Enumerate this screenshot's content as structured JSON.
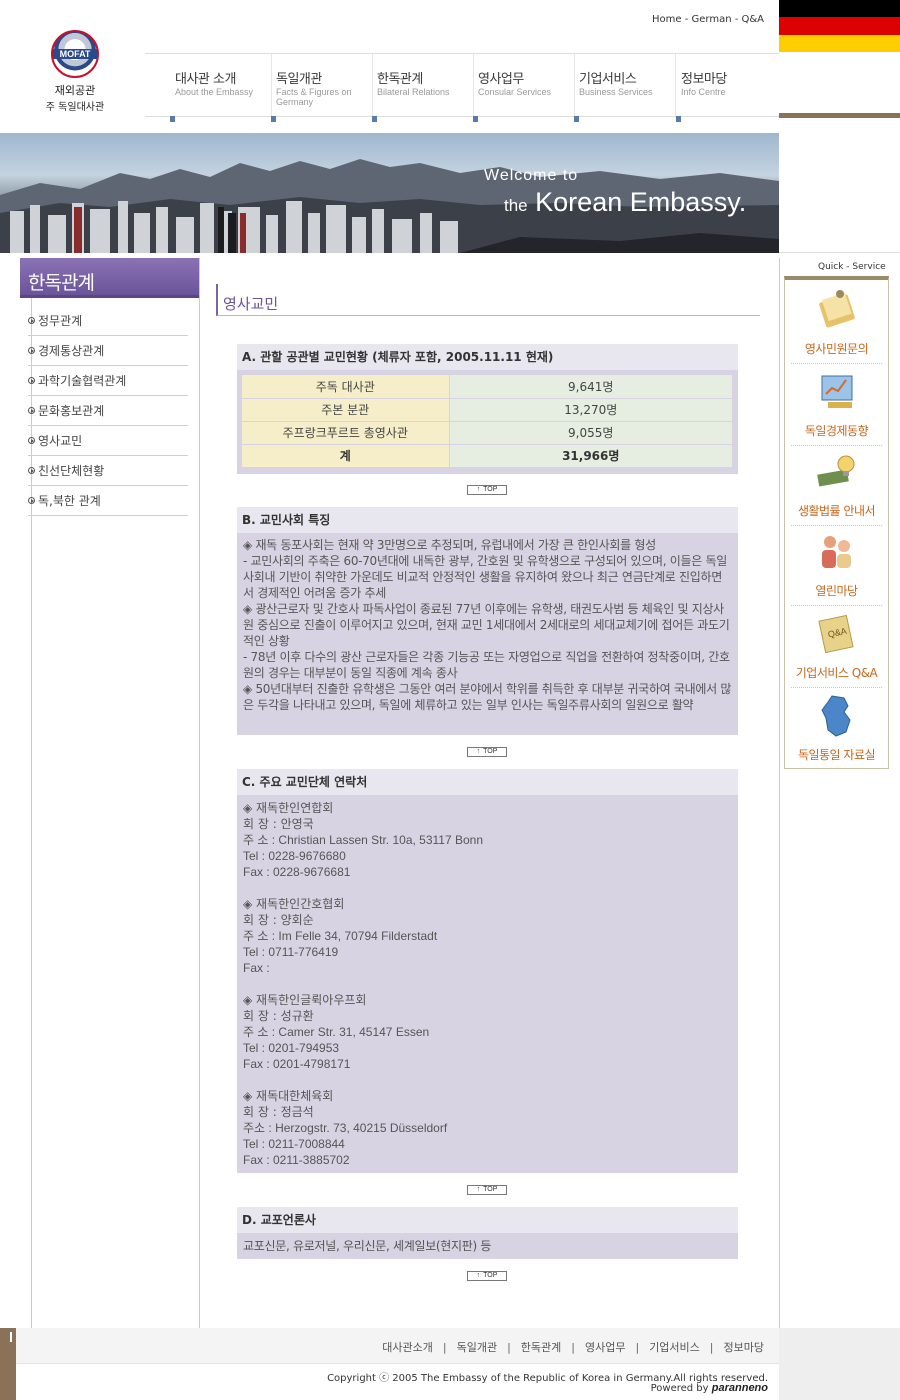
{
  "logo": {
    "emblem_text": "MOFAT",
    "line1": "재외공관",
    "line2": "주 독일대사관"
  },
  "topnav": [
    "Home",
    "German",
    "Q&A"
  ],
  "topnav_sep": " - ",
  "flag_colors": [
    "#000000",
    "#dd0000",
    "#ffce00"
  ],
  "gnb": [
    {
      "ko": "대사관 소개",
      "en": "About the Embassy"
    },
    {
      "ko": "독일개관",
      "en": "Facts & Figures on Germany"
    },
    {
      "ko": "한독관계",
      "en": "Bilateral Relations"
    },
    {
      "ko": "영사업무",
      "en": "Consular Services"
    },
    {
      "ko": "기업서비스",
      "en": "Business Services"
    },
    {
      "ko": "정보마당",
      "en": "Info Centre"
    }
  ],
  "banner": {
    "welcome": "Welcome to",
    "the": "the",
    "title": "Korean Embassy."
  },
  "lnb": {
    "title": "한독관계",
    "items": [
      "정무관계",
      "경제통상관계",
      "과학기술협력관계",
      "문화홍보관계",
      "영사교민",
      "친선단체현황",
      "독,북한 관계"
    ]
  },
  "page_title": "영사교민",
  "top_label": "TOP",
  "section_a": {
    "title": "A. 관할 공관별 교민현황 (체류자 포함, 2005.11.11 현재)",
    "rows": [
      {
        "label": "주독 대사관",
        "value": "9,641명"
      },
      {
        "label": "주본 분관",
        "value": "13,270명"
      },
      {
        "label": "주프랑크푸르트 총영사관",
        "value": "9,055명"
      }
    ],
    "total": {
      "label": "계",
      "value": "31,966명"
    }
  },
  "section_b": {
    "title": "B. 교민사회 특징",
    "paragraphs": [
      "◈ 재독 동포사회는 현재 약 3만명으로 추정되며, 유럽내에서 가장 큰 한인사회를 형성",
      "- 교민사회의 주축은 60-70년대에 내독한 광부, 간호원 및 유학생으로 구성되어 있으며, 이들은 독일 사회내 기반이 취약한 가운데도 비교적 안정적인 생활을 유지하여 왔으나 최근 연금단계로 진입하면서 경제적인 어려움 증가 추세",
      "◈ 광산근로자 및 간호사 파독사업이 종료된 77년 이후에는 유학생, 태권도사범 등 체육인 및 지상사원 중심으로 진출이 이루어지고 있으며, 현재 교민 1세대에서 2세대로의 세대교체기에 접어든 과도기적인 상황",
      "- 78년 이후 다수의 광산 근로자들은 각종 기능공 또는 자영업으로 직업을 전환하여 정착중이며, 간호원의 경우는 대부분이 동일 직종에 계속 종사",
      "◈ 50년대부터 진출한 유학생은 그동안 여러 분야에서 학위를 취득한 후 대부분 귀국하여 국내에서 많은 두각을 나타내고 있으며, 독일에 체류하고 있는 일부 인사는 독일주류사회의 일원으로 활약"
    ]
  },
  "section_c": {
    "title": "C. 주요 교민단체 연락처",
    "orgs": [
      {
        "name": "◈ 재독한인연합회",
        "head": "회 장 : 안영국",
        "addr": "주 소 : Christian Lassen Str. 10a, 53117 Bonn",
        "tel": "Tel : 0228-9676680",
        "fax": "Fax : 0228-9676681"
      },
      {
        "name": "◈ 재독한인간호협회",
        "head": "회 장 : 양회순",
        "addr": "주 소 : Im Felle 34, 70794 Filderstadt",
        "tel": "Tel : 0711-776419",
        "fax": "Fax :"
      },
      {
        "name": "◈ 재독한인글뤽아우프회",
        "head": "회 장 : 성규환",
        "addr": "주 소 : Camer Str. 31, 45147 Essen",
        "tel": "Tel : 0201-794953",
        "fax": "Fax : 0201-4798171"
      },
      {
        "name": "◈ 재독대한체육회",
        "head": "회 장 : 정금석",
        "addr": "주소 : Herzogstr. 73, 40215 Düsseldorf",
        "tel": "Tel : 0211-7008844",
        "fax": "Fax : 0211-3885702"
      }
    ]
  },
  "section_d": {
    "title": "D. 교포언론사",
    "text": "교포신문, 유로저널, 우리신문, 세계일보(현지판) 등"
  },
  "quick": {
    "label": "Quick - Service",
    "items": [
      {
        "label": "영사민원문의",
        "icon": "notepad-icon"
      },
      {
        "label": "독일경제동향",
        "icon": "chart-monitor-icon"
      },
      {
        "label": "생활법률 안내서",
        "icon": "book-bulb-icon"
      },
      {
        "label": "열린마당",
        "icon": "people-icon"
      },
      {
        "label": "기업서비스 Q&A",
        "icon": "qa-note-icon"
      },
      {
        "label": "독일통일 자료실",
        "icon": "germany-map-icon"
      }
    ]
  },
  "footer": {
    "links": [
      "대사관소개",
      "독일개관",
      "한독관계",
      "영사업무",
      "기업서비스",
      "정보마당"
    ],
    "link_sep": "|",
    "copyright": "Copyright ⓒ 2005 The Embassy of the Republic of Korea in Germany.All rights reserved.",
    "powered_by": "Powered by",
    "powered_brand": "paranneno"
  },
  "colors": {
    "accent_purple": "#6b5499",
    "section_bg": "#d8d3e3",
    "quick_label": "#c8671b",
    "brown": "#8b7157"
  }
}
